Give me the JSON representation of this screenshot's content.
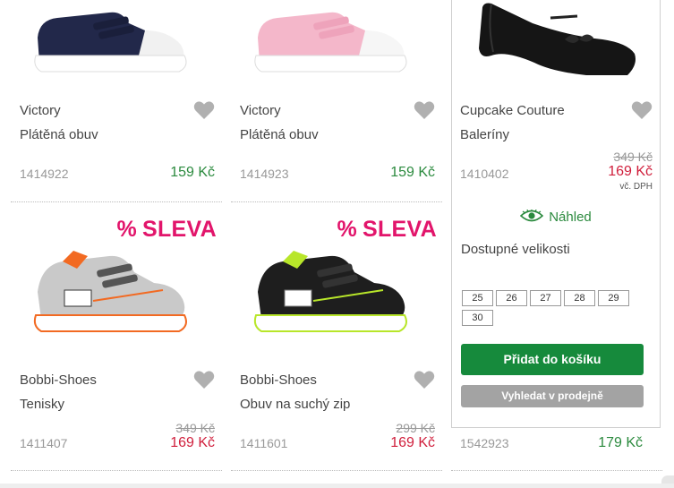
{
  "sale_badge": {
    "pct": "%",
    "text": "SLEVA"
  },
  "currency": "Kč",
  "products": [
    {
      "brand": "Victory",
      "name": "Plátěná obuv",
      "code": "1414922",
      "price": "159 Kč",
      "old_price": "",
      "shoe": "navy-canvas"
    },
    {
      "brand": "Victory",
      "name": "Plátěná obuv",
      "code": "1414923",
      "price": "159 Kč",
      "old_price": "",
      "shoe": "pink-canvas"
    },
    {
      "brand": "Cupcake Couture",
      "name": "Baleríny",
      "code": "1410402",
      "price": "169 Kč",
      "old_price": "349 Kč",
      "shoe": "black-ballerina"
    },
    {
      "brand": "Bobbi-Shoes",
      "name": "Tenisky",
      "code": "1411407",
      "price": "169 Kč",
      "old_price": "349 Kč",
      "shoe": "grey-sneaker",
      "sale": true
    },
    {
      "brand": "Bobbi-Shoes",
      "name": "Obuv na suchý zip",
      "code": "1411601",
      "price": "169 Kč",
      "old_price": "299 Kč",
      "shoe": "black-velcro-sneaker",
      "sale": true
    },
    {
      "brand": "",
      "name": "",
      "code": "1542923",
      "price": "179 Kč",
      "old_price": ""
    }
  ],
  "expanded": {
    "vat_note": "vč. DPH",
    "preview_label": "Náhled",
    "sizes_title": "Dostupné velikosti",
    "sizes": [
      "25",
      "26",
      "27",
      "28",
      "29",
      "30"
    ],
    "add_to_cart": "Přidat do košíku",
    "find_in_store": "Vyhledat v prodejně"
  },
  "colors": {
    "sale": "#e2156b",
    "discount_price": "#d01f3c",
    "regular_price": "#2b8a3e",
    "cta": "#168a3c",
    "secondary_btn": "#a3a3a3"
  },
  "icons": {
    "favorite": "heart-icon",
    "preview": "eye-icon"
  }
}
